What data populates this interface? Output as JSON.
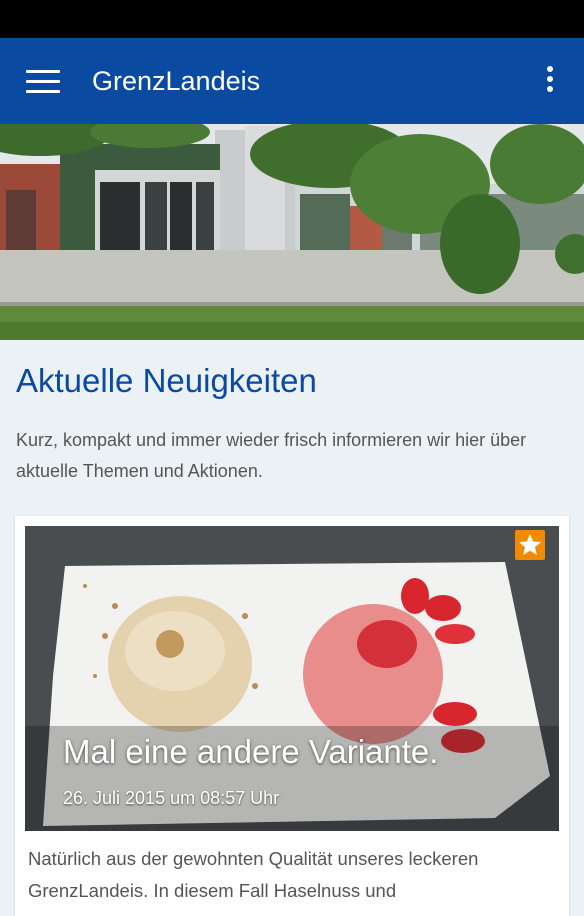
{
  "app_bar": {
    "title": "GrenzLandeis",
    "menu_icon": "hamburger-menu-icon",
    "overflow_icon": "more-vert-icon",
    "color": "#0a4aa1"
  },
  "news": {
    "heading": "Aktuelle Neuigkeiten",
    "intro": "Kurz, kompakt und immer wieder frisch informieren wir hier über aktuelle Themen und Aktionen."
  },
  "article": {
    "headline": "Mal eine andere Variante.",
    "date": "26. Juli 2015 um 08:57 Uhr",
    "excerpt": "Natürlich aus der gewohnten Qualität unseres leckeren GrenzLandeis. In diesem Fall Haselnuss und",
    "favorite_icon": "star-icon",
    "favorite_color": "#f08a00"
  }
}
